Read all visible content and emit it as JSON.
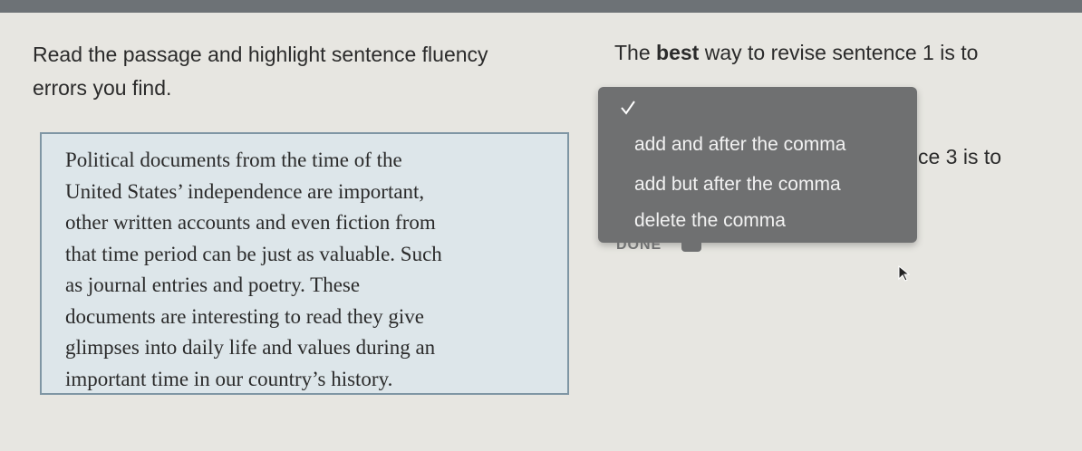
{
  "instructions": {
    "line1": "Read the passage and highlight sentence fluency",
    "line2": "errors you find."
  },
  "passage": {
    "lines": [
      "Political documents from the time of the",
      "United States’ independence are important,",
      "other written accounts and even fiction from",
      "that time period can be just as valuable. Such",
      "as journal entries and poetry. These",
      "documents are interesting to read they give",
      "glimpses into daily life and values during an",
      "important time in our country’s history."
    ]
  },
  "question": {
    "before": "The ",
    "bold": "best",
    "after": " way to revise sentence 1 is to",
    "tail": "ce 3 is to"
  },
  "dropdown": {
    "options": [
      "add and after the comma",
      "add but after the comma",
      "delete the comma"
    ],
    "done_label": "DONE"
  },
  "colors": {
    "panel": "#6f7071",
    "passage_bg": "#dde6ea",
    "passage_border": "#7f96a4"
  },
  "icons": [
    "checkmark-icon",
    "mouse-cursor-icon"
  ]
}
